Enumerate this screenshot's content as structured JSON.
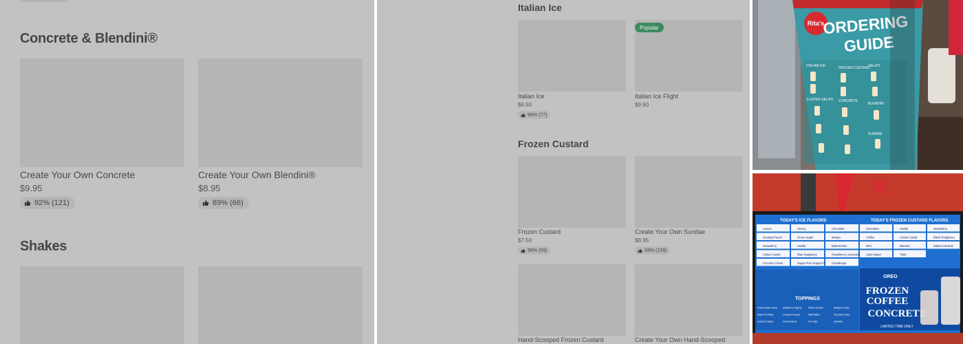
{
  "panel1": {
    "sections": [
      {
        "title": "Concrete & Blendini®",
        "items": [
          {
            "name": "Create Your Own Concrete",
            "price": "$9.95",
            "rating": "92% (121)"
          },
          {
            "name": "Create Your Own Blendini®",
            "price": "$8.95",
            "rating": "89% (66)"
          }
        ]
      },
      {
        "title": "Shakes"
      }
    ]
  },
  "panel2": {
    "sections": [
      {
        "title": "Italian Ice",
        "items": [
          {
            "name": "Italian Ice",
            "price": "$6.50",
            "rating": "96% (77)"
          },
          {
            "name": "Italian Ice Flight",
            "price": "$9.90",
            "badge": "Popular"
          }
        ]
      },
      {
        "title": "Frozen Custard",
        "items": [
          {
            "name": "Frozen Custard",
            "price": "$7.50",
            "rating": "96% (59)"
          },
          {
            "name": "Create Your Own Sundae",
            "price": "$8.95",
            "rating": "93% (139)"
          },
          {
            "name": "Hand-Scooped Frozen Custard"
          },
          {
            "name": "Create Your Own Hand-Scooped"
          }
        ]
      }
    ]
  },
  "photo1": {
    "brand": "Rita's",
    "title_line1": "ORDERING",
    "title_line2": "GUIDE",
    "col1_a": "ITALIAN ICE",
    "col1_b": "3-LAYER GELATI",
    "col2_a": "FROZEN CUSTARD",
    "col2_b": "CONCRETE",
    "col3_a": "GELATI",
    "col3_b": "BLENDINI",
    "col3_c": "SUNDAE"
  },
  "photo2": {
    "ice_header": "TODAY'S ICE FLAVORS",
    "custard_header": "TODAY'S FROZEN CUSTARD FLAVORS",
    "ice_flavors": [
      "Lemon",
      "Cherry",
      "Chocolate",
      "Georgia Peach",
      "Green Apple",
      "Mango",
      "Strawberry",
      "Vanilla",
      "Watermelon",
      "Cotton Candy",
      "Blue Raspberry",
      "Strawberry Lemonade",
      "Coconut Cream",
      "Sugar-Free Dragon Fruit",
      "Cantaloupe"
    ],
    "custard_flavors": [
      "Chocolate",
      "Vanilla",
      "Strawberry",
      "Coffee",
      "Cotton Candy",
      "Black Raspberry",
      "Mint",
      "Banana",
      "Salted Caramel",
      "Cake Batter",
      "Twist"
    ],
    "toppings_header": "TOPPINGS",
    "toppings": [
      "Peanut Butter Sauce",
      "Strawberry Topping",
      "Whole Cherries",
      "Whipped Cream",
      "Apple Pie Filling",
      "Chopped Peanuts",
      "Nilla Wafers",
      "Chocolate Chips",
      "Graham Cracker",
      "Gummy Bears",
      "Pie Chips",
      "Sprinkles"
    ],
    "promo_brand": "OREO",
    "promo_line1": "FROZEN",
    "promo_line2": "COFFEE",
    "promo_line3": "CONCRETE",
    "promo_tag": "LIMITED TIME ONLY"
  },
  "colors": {
    "panel_bg": "#c2c2c2",
    "placeholder": "#b5b5b5",
    "popular_badge": "#3d8a61",
    "board_blue": "#1e6fd0",
    "guide_teal": "#3a9aa5"
  }
}
